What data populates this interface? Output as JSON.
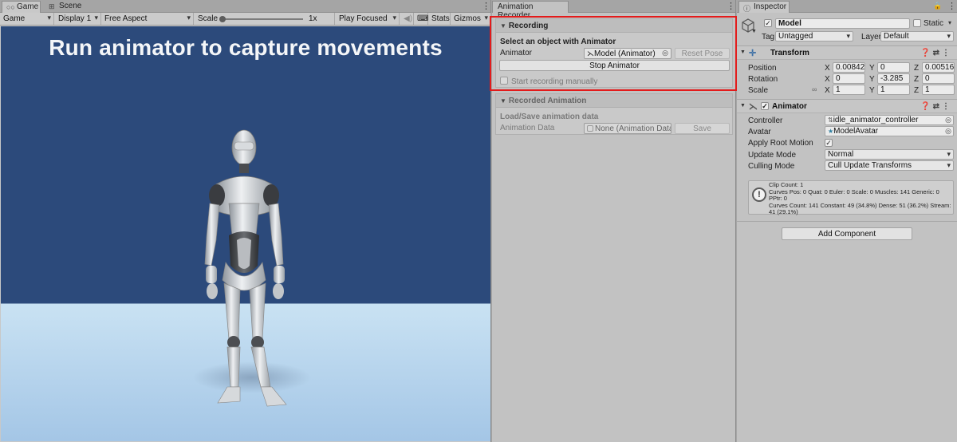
{
  "game": {
    "tabs": [
      {
        "label": "Game",
        "icon": "gamepad-icon"
      },
      {
        "label": "Scene",
        "icon": "grid-icon"
      }
    ],
    "toolbar": {
      "view_select": "Game",
      "display": "Display 1",
      "aspect": "Free Aspect",
      "scale_label": "Scale",
      "scale_value": "1x",
      "scale_level": 0,
      "play_mode": "Play Focused",
      "stats": "Stats",
      "gizmos": "Gizmos"
    },
    "viewport_title": "Run animator to capture movements"
  },
  "recorder": {
    "tab": "Animation Recorder",
    "recording": {
      "header": "Recording",
      "prompt": "Select an object with Animator",
      "animator_label": "Animator",
      "animator_value": "Model (Animator)",
      "reset_pose": "Reset Pose",
      "stop_animator": "Stop Animator",
      "manual_label": "Start recording manually"
    },
    "recorded": {
      "header": "Recorded Animation",
      "subheader": "Load/Save animation data",
      "data_label": "Animation Data",
      "data_value": "None (Animation Data",
      "save": "Save"
    },
    "highlight_color": "#e31b1b"
  },
  "inspector": {
    "tab": "Inspector",
    "object": {
      "name": "Model",
      "active": true,
      "static_label": "Static",
      "tag_label": "Tag",
      "tag_value": "Untagged",
      "layer_label": "Layer",
      "layer_value": "Default"
    },
    "transform": {
      "title": "Transform",
      "rows": [
        {
          "label": "Position",
          "x": "0.008426",
          "y": "0",
          "z": "0.005161"
        },
        {
          "label": "Rotation",
          "x": "0",
          "y": "-3.285",
          "z": "0"
        },
        {
          "label": "Scale",
          "x": "1",
          "y": "1",
          "z": "1"
        }
      ]
    },
    "animator": {
      "title": "Animator",
      "enabled": true,
      "controller_label": "Controller",
      "controller_value": "idle_animator_controller",
      "avatar_label": "Avatar",
      "avatar_value": "ModelAvatar",
      "root_motion_label": "Apply Root Motion",
      "root_motion": true,
      "update_mode_label": "Update Mode",
      "update_mode_value": "Normal",
      "culling_mode_label": "Culling Mode",
      "culling_mode_value": "Cull Update Transforms",
      "info": "Clip Count: 1\nCurves Pos: 0 Quat: 0 Euler: 0 Scale: 0 Muscles: 141 Generic: 0 PPtr: 0\nCurves Count: 141 Constant: 49 (34.8%) Dense: 51 (36.2%) Stream: 41 (29.1%)"
    },
    "add_component": "Add Component"
  }
}
